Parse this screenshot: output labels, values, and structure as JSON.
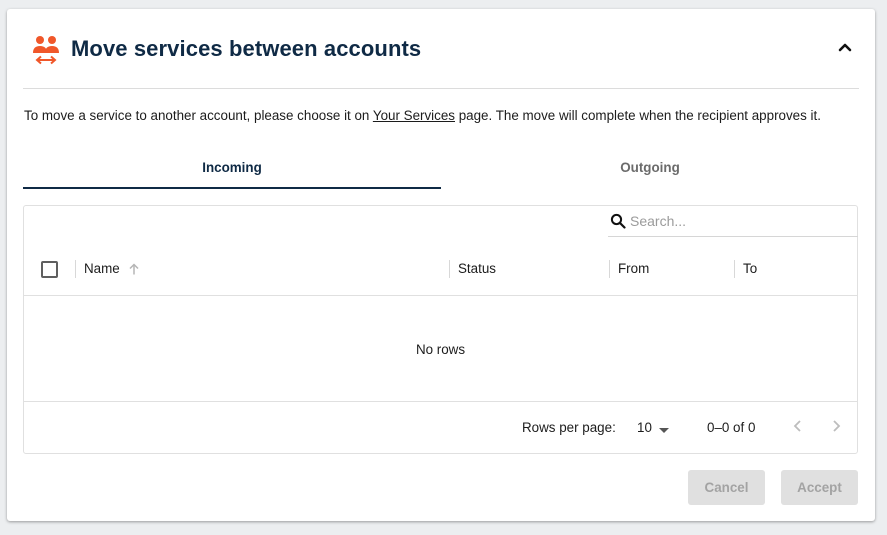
{
  "panel": {
    "title": "Move services between accounts",
    "icon": "users-transfer-icon",
    "collapse_icon": "chevron-up-icon"
  },
  "description": {
    "before_link": "To move a service to another account, please choose it on ",
    "link_text": "Your Services",
    "after_link": " page. The move will complete when the recipient approves it."
  },
  "tabs": [
    {
      "label": "Incoming",
      "active": true
    },
    {
      "label": "Outgoing",
      "active": false
    }
  ],
  "grid": {
    "search_placeholder": "Search...",
    "columns": [
      {
        "label": "Name",
        "sorted": "asc"
      },
      {
        "label": "Status"
      },
      {
        "label": "From"
      },
      {
        "label": "To"
      }
    ],
    "empty_text": "No rows",
    "footer": {
      "rows_per_page_label": "Rows per page:",
      "rows_per_page_value": "10",
      "range_text": "0–0 of 0"
    }
  },
  "actions": {
    "cancel_label": "Cancel",
    "accept_label": "Accept"
  },
  "colors": {
    "title": "#0f2a45",
    "icon_accent": "#f0572a",
    "disabled_button_bg": "#e0e0e0",
    "disabled_button_text": "#a3a3a3"
  }
}
